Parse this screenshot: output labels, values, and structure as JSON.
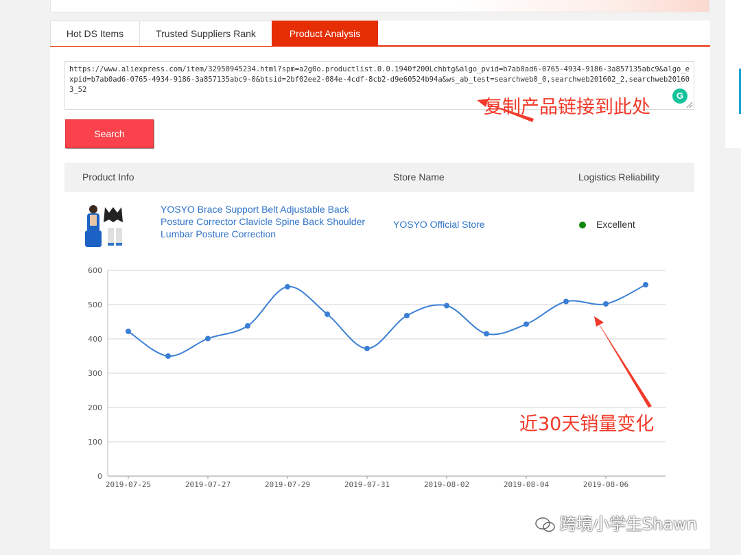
{
  "tabs": [
    {
      "label": "Hot DS Items"
    },
    {
      "label": "Trusted Suppliers Rank"
    },
    {
      "label": "Product Analysis"
    }
  ],
  "search": {
    "url_value": "https://www.aliexpress.com/item/32950945234.html?spm=a2g0o.productlist.0.0.1940f200Lchbtg&algo_pvid=b7ab0ad6-0765-4934-9186-3a857135abc9&algo_expid=b7ab0ad6-0765-4934-9186-3a857135abc9-0&btsid=2bf02ee2-084e-4cdf-8cb2-d9e60524b94a&ws_ab_test=searchweb0_0,searchweb201602_2,searchweb201603_52",
    "button_label": "Search"
  },
  "annotations": {
    "copy_link": "复制产品链接到此处",
    "sales_change": "近30天销量变化"
  },
  "table": {
    "headers": {
      "product_info": "Product Info",
      "store_name": "Store Name",
      "logistics": "Logistics Reliability"
    },
    "row": {
      "product_title": "YOSYO Brace Support Belt Adjustable Back Posture Corrector Clavicle Spine Back Shoulder Lumbar Posture Correction",
      "store": "YOSYO Official Store",
      "logistics": "Excellent",
      "logistics_color": "#13880f"
    }
  },
  "watermark": "跨境小学生Shawn",
  "colors": {
    "accent": "#e62e04",
    "button": "#f9424b",
    "link": "#2f73c8",
    "line": "#3a7fd5",
    "annotation": "#f23a2a"
  },
  "chart_data": {
    "type": "line",
    "x_tick_labels": [
      "2019-07-25",
      "2019-07-27",
      "2019-07-29",
      "2019-07-31",
      "2019-08-02",
      "2019-08-04",
      "2019-08-06"
    ],
    "y_tick_labels": [
      "0",
      "100",
      "200",
      "300",
      "400",
      "500",
      "600"
    ],
    "ylim": [
      0,
      600
    ],
    "x": [
      "2019-07-25",
      "2019-07-26",
      "2019-07-27",
      "2019-07-28",
      "2019-07-29",
      "2019-07-30",
      "2019-07-31",
      "2019-08-01",
      "2019-08-02",
      "2019-08-03",
      "2019-08-04",
      "2019-08-05",
      "2019-08-06",
      "2019-08-07"
    ],
    "values": [
      422,
      350,
      401,
      438,
      552,
      472,
      372,
      468,
      497,
      415,
      443,
      509,
      502,
      558
    ],
    "grid": true
  }
}
